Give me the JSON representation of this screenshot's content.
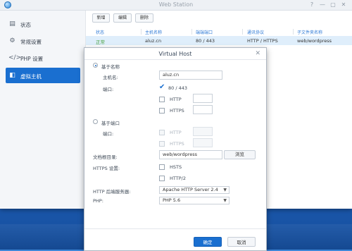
{
  "window": {
    "title": "Web Station",
    "controls": [
      "?",
      "—",
      "▢",
      "✕"
    ]
  },
  "sidebar": {
    "items": [
      {
        "label": "状态",
        "icon": "status-icon",
        "active": false
      },
      {
        "label": "常规设置",
        "icon": "gear-icon",
        "active": false
      },
      {
        "label": "PHP 设置",
        "icon": "code-icon",
        "active": false
      },
      {
        "label": "虚拟主机",
        "icon": "virtual-host-icon",
        "active": true
      }
    ]
  },
  "toolbar": {
    "create_label": "新增",
    "edit_label": "编辑",
    "delete_label": "删除"
  },
  "table": {
    "columns": [
      "状态",
      "主机名称",
      "端端端口",
      "通讯协议",
      "子文件夹名称"
    ],
    "rows": [
      {
        "status": "正常",
        "hostname": "aluz.cn",
        "port": "80 / 443",
        "protocol": "HTTP / HTTPS",
        "folder": "web/wordpress"
      }
    ]
  },
  "dialog": {
    "title": "Virtual Host",
    "by_name_label": "基于名称",
    "hostname_label": "主机名:",
    "hostname_value": "aluz.cn",
    "port_label": "端口:",
    "port_combo_label": "80 / 443",
    "http_label": "HTTP",
    "https_label": "HTTPS",
    "by_port_label": "基于端口",
    "port2_label": "端口:",
    "http2_label": "HTTP",
    "https2_label": "HTTPS",
    "doc_root_label": "文档根目录:",
    "doc_root_value": "web/wordpress",
    "browse_label": "浏览",
    "https_settings_label": "HTTPS 设置:",
    "hsts_label": "HSTS",
    "http2_proto_label": "HTTP/2",
    "backend_label": "HTTP 后端服务器:",
    "backend_value": "Apache HTTP Server 2.4",
    "php_label": "PHP:",
    "php_value": "PHP 5.6",
    "ok_label": "确定",
    "cancel_label": "取消"
  },
  "colors": {
    "accent": "#1a6fd0",
    "status_ok": "#4aa341",
    "selected_row": "#dfeefb"
  }
}
